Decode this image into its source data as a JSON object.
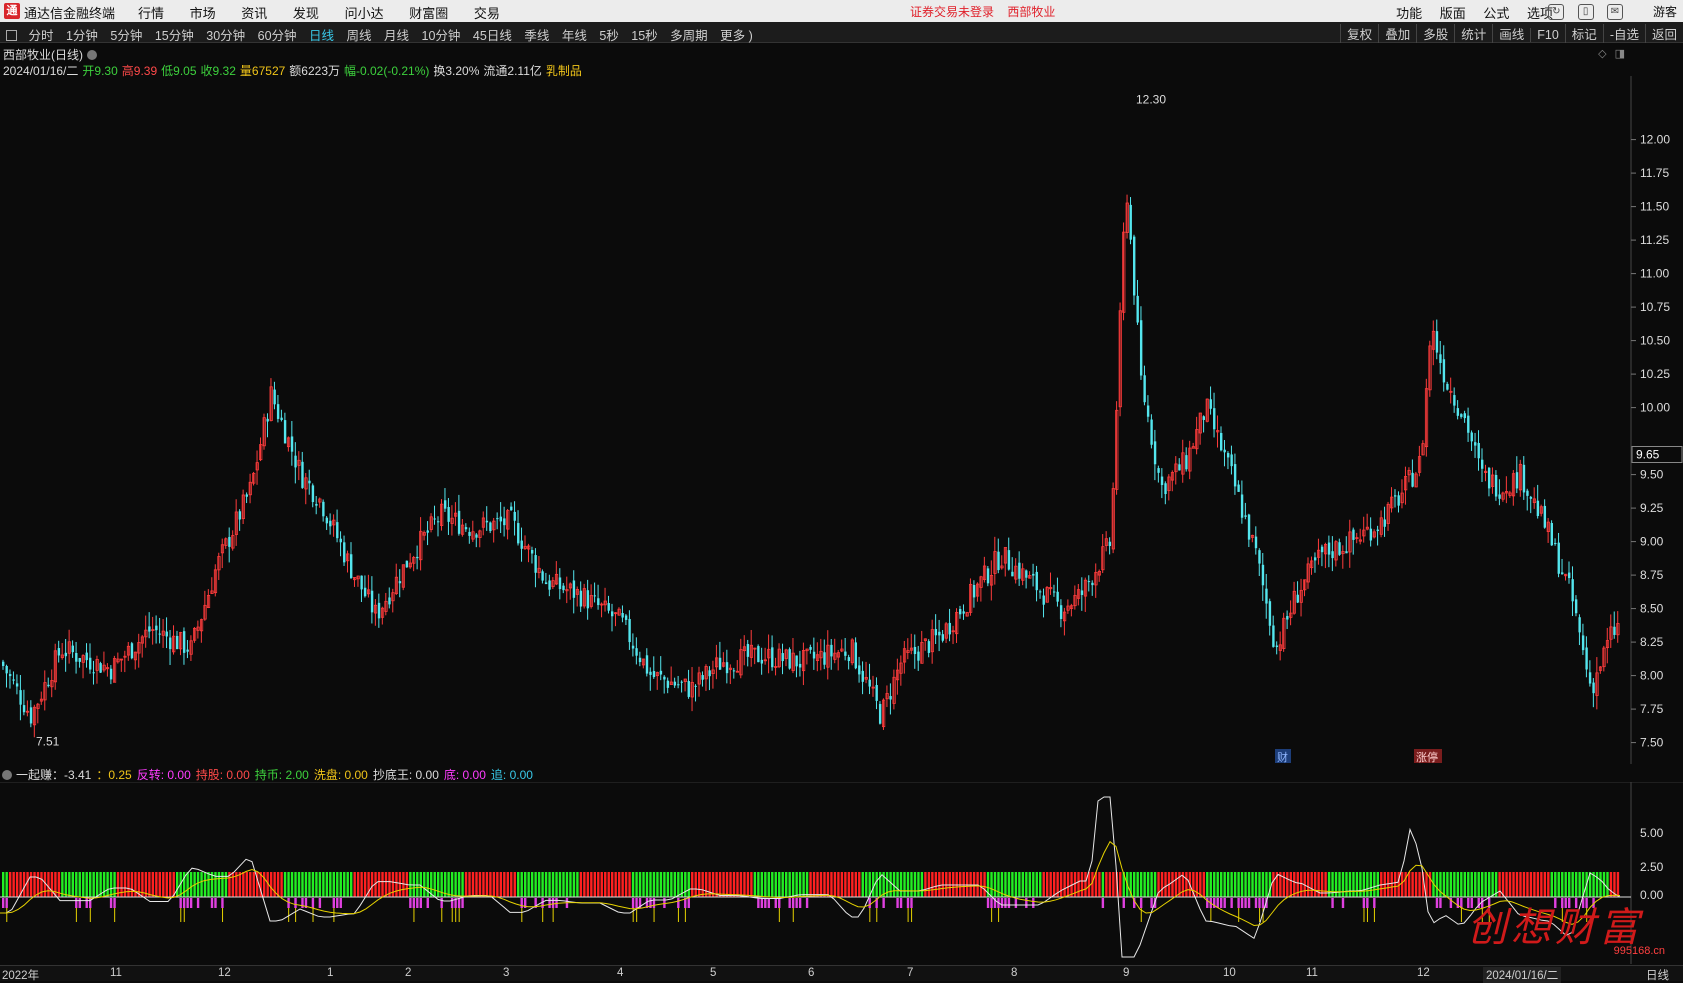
{
  "titlebar": {
    "logo": "通",
    "app_name": "通达信金融终端",
    "menu": [
      "行情",
      "市场",
      "资讯",
      "发现",
      "问小达",
      "财富圈",
      "交易"
    ],
    "notice": "证券交易未登录",
    "stock_name": "西部牧业",
    "right_menu": [
      "功能",
      "版面",
      "公式",
      "选项"
    ],
    "user": "游客"
  },
  "toolbar": {
    "periods": [
      "分时",
      "1分钟",
      "5分钟",
      "15分钟",
      "30分钟",
      "60分钟",
      "日线",
      "周线",
      "月线",
      "10分钟",
      "45日线",
      "季线",
      "年线",
      "5秒",
      "15秒",
      "多周期",
      "更多 )"
    ],
    "active_period": "日线",
    "tools": [
      "复权",
      "叠加",
      "多股",
      "统计",
      "画线",
      "F10",
      "标记",
      "-自选",
      "返回"
    ]
  },
  "stock": {
    "title": "西部牧业(日线)",
    "date": "2024/01/16/二",
    "open_label": "开",
    "open": "9.30",
    "high_label": "高",
    "high": "9.39",
    "low_label": "低",
    "low": "9.05",
    "close_label": "收",
    "close": "9.32",
    "vol_label": "量",
    "vol": "67527",
    "amount": "额6223万",
    "change": "幅-0.02(-0.21%)",
    "turnover": "换3.20%",
    "float": "流通2.11亿",
    "sector": "乳制品"
  },
  "price_axis": {
    "ticks": [
      "12.00",
      "11.75",
      "11.50",
      "11.25",
      "11.00",
      "10.75",
      "10.50",
      "10.25",
      "10.00",
      "9.50",
      "9.25",
      "9.00",
      "8.75",
      "8.50",
      "8.25",
      "8.00",
      "7.75",
      "7.50"
    ],
    "current": "9.65",
    "max_label": "12.30",
    "min_label": "7.51"
  },
  "markers": {
    "fin": "财",
    "limit": "涨停"
  },
  "indicator": {
    "name": "一起赚：-3.41",
    "v1": "：0.25",
    "fanzhuan": "反转: 0.00",
    "chigu": "持股: 0.00",
    "chibi": "持币: 2.00",
    "xipan": "洗盘: 0.00",
    "chaodiwang": "抄底王: 0.00",
    "di": "底: 0.00",
    "zhui": "追: 0.00",
    "axis": [
      "5.00",
      "2.50",
      "0.00"
    ]
  },
  "date_axis": {
    "labels": [
      "2022年",
      "11",
      "12",
      "1",
      "2",
      "3",
      "4",
      "5",
      "6",
      "7",
      "8",
      "9",
      "10",
      "11",
      "12",
      "2024/01/16/二"
    ],
    "period": "日线"
  },
  "watermark": {
    "text": "创想财富",
    "url": "995168.cn"
  },
  "colors": {
    "up": "#ff3c3c",
    "down": "#54e6ee",
    "bg": "#0b0b0b",
    "accent": "#39c8e8"
  },
  "chart_data": {
    "type": "candlestick",
    "ylim": [
      7.4,
      12.4
    ],
    "max": 12.3,
    "min": 7.51,
    "current": 9.65,
    "x_range": [
      "2022-10",
      "2024-01-16"
    ]
  }
}
